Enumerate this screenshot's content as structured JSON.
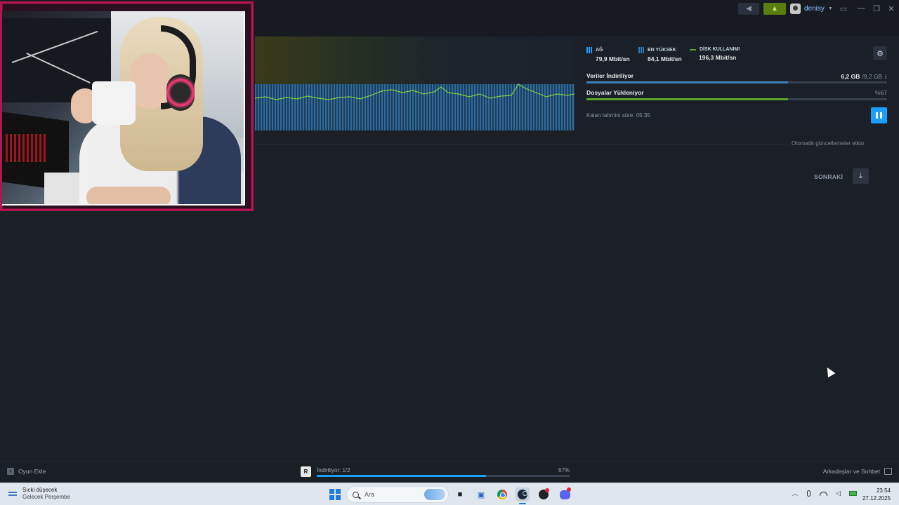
{
  "topbar": {
    "announce_icon": "megaphone-icon",
    "notification_icon": "bell-icon",
    "username": "denisy",
    "window_controls": [
      "monitor-icon",
      "minimize-icon",
      "restore-icon",
      "close-icon"
    ]
  },
  "stats": {
    "network": {
      "label": "AĞ",
      "value": "79,9 Mbit/sn"
    },
    "peak": {
      "label": "EN YÜKSEK",
      "value": "84,1 Mbit/sn"
    },
    "disk": {
      "label": "DİSK KULLANIMI",
      "value": "196,3 Mbit/sn"
    }
  },
  "download": {
    "data_label": "Veriler İndiriliyor",
    "data_done": "6,2 GB",
    "data_total": "/9,2 GB",
    "data_progress": 0.67,
    "files_label": "Dosyalar Yükleniyor",
    "files_percent": "%67",
    "files_progress": 0.67,
    "eta": "Kalan tahmini süre: 05:35"
  },
  "queue": {
    "auto_updates": "Otomatik güncellemeler etkin",
    "next_label": "SONRAKİ"
  },
  "bottombar": {
    "add_game": "Oyun Ekle",
    "game_icon_text": "R",
    "dl_status": "İndiriliyor: 1/2",
    "dl_percent": "67%",
    "dl_progress": 0.67,
    "friends": "Arkadaşlar ve Sohbet"
  },
  "taskbar": {
    "weather_line1": "Sıcki düşecek",
    "weather_line2": "Gelecek Perşembe",
    "search_placeholder": "Ara",
    "time": "23:54",
    "date": "27.12.2025"
  },
  "colors": {
    "accent": "#1a9fff",
    "disk_green": "#5ba32b",
    "notification_green": "#5c7e10",
    "webcam_border": "#b0174f"
  }
}
